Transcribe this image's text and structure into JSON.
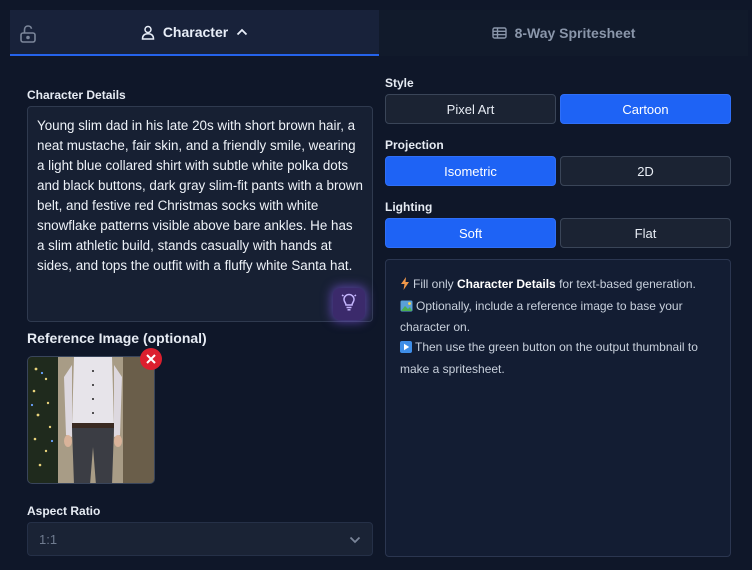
{
  "tabs": {
    "lock_icon": "lock-open-icon",
    "character": {
      "label": "Character",
      "icon": "user-icon",
      "chevron": "chevron-up-icon"
    },
    "spritesheet": {
      "label": "8-Way Spritesheet",
      "icon": "sprite-grid-icon"
    }
  },
  "left": {
    "details_label": "Character Details",
    "details_text": "Young slim dad in his late 20s with short brown hair, a neat mustache, fair skin, and a friendly smile, wearing a light blue collared shirt with subtle white polka dots and black buttons, dark gray slim-fit pants with a brown belt, and festive red Christmas socks with white snowflake patterns visible above bare ankles. He has a slim athletic build, stands casually with hands at sides, and tops the outfit with a fluffy white Santa hat.",
    "enhance_icon": "lightbulb-icon",
    "reference_label": "Reference Image (optional)",
    "remove_icon": "close-icon",
    "aspect_label": "Aspect Ratio",
    "aspect_value": "1:1"
  },
  "right": {
    "style": {
      "label": "Style",
      "options": [
        "Pixel Art",
        "Cartoon"
      ],
      "selected": "Cartoon"
    },
    "projection": {
      "label": "Projection",
      "options": [
        "Isometric",
        "2D"
      ],
      "selected": "Isometric"
    },
    "lighting": {
      "label": "Lighting",
      "options": [
        "Soft",
        "Flat"
      ],
      "selected": "Soft"
    },
    "info": {
      "line1_pre": "Fill only ",
      "line1_bold": "Character Details",
      "line1_post": " for text-based generation.",
      "line2": "Optionally, include a reference image to base your character on.",
      "line3": "Then use the green button on the output thumbnail to make a spritesheet."
    }
  },
  "colors": {
    "accent": "#1e63f5",
    "remove": "#dc1f2e",
    "glow": "#8b5cf6"
  }
}
